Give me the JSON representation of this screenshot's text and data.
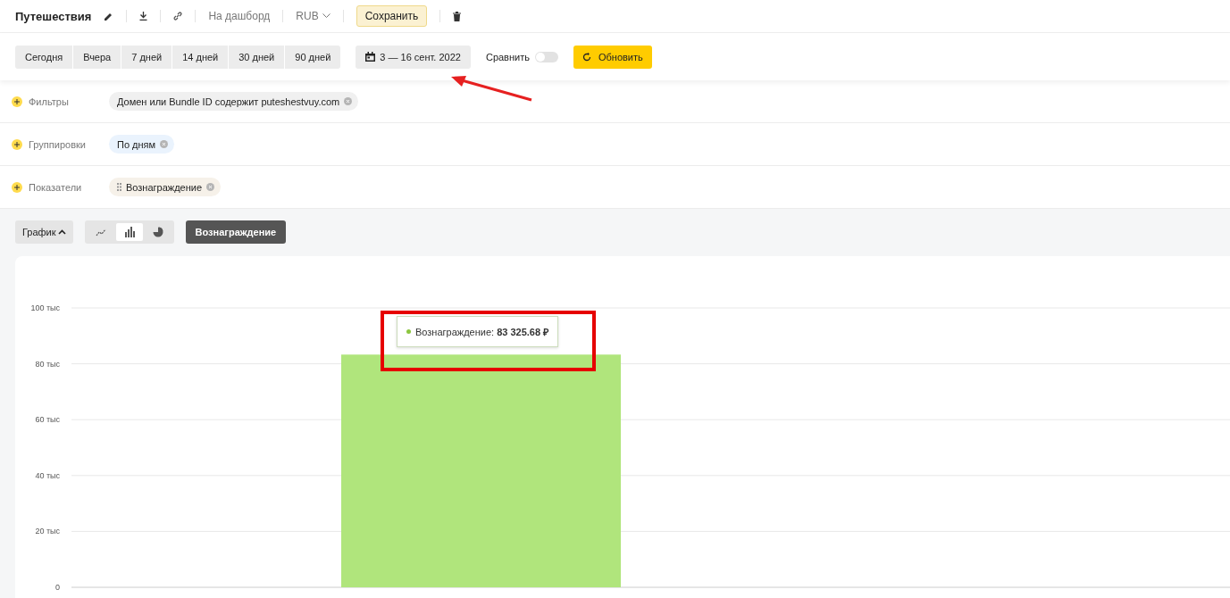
{
  "header": {
    "title": "Путешествия",
    "dashboard_link": "На дашборд",
    "currency": "RUB",
    "save": "Сохранить"
  },
  "periods": [
    {
      "label": "Сегодня",
      "selected": false
    },
    {
      "label": "Вчера",
      "selected": false
    },
    {
      "label": "7 дней",
      "selected": false
    },
    {
      "label": "14 дней",
      "selected": false
    },
    {
      "label": "30 дней",
      "selected": false
    },
    {
      "label": "90 дней",
      "selected": false
    }
  ],
  "date_range": "3 — 16 сент. 2022",
  "compare": {
    "label": "Сравнить",
    "on": false
  },
  "refresh": "Обновить",
  "rows": [
    {
      "kind": "filter",
      "label": "Фильтры",
      "chip": "Домен или Bundle ID содержит puteshestvuy.com"
    },
    {
      "kind": "grouping",
      "label": "Группировки",
      "chip": "По дням"
    },
    {
      "kind": "metric",
      "label": "Показатели",
      "chip": "Вознаграждение"
    }
  ],
  "view": {
    "toggle": "График",
    "expanded": true,
    "chart_types": [
      {
        "kind": "line",
        "selected": false
      },
      {
        "kind": "bar",
        "selected": true
      },
      {
        "kind": "pie",
        "selected": false
      }
    ],
    "metric": "Вознаграждение"
  },
  "chart": {
    "tooltip": {
      "text": "Вознаграждение: **83 325.68 ₽**",
      "color": "#8cc63f"
    },
    "chart_data": {
      "type": "bar",
      "grid": true,
      "series": [
        {
          "color": "#b0e57c",
          "values": [
            83.3
          ]
        }
      ],
      "ylim": [
        0,
        100
      ],
      "yticks": [
        {
          "value": 0,
          "label": "0"
        },
        {
          "value": 20,
          "label": "20 тыс"
        },
        {
          "value": 40,
          "label": "40 тыс"
        },
        {
          "value": 60,
          "label": "60 тыс"
        },
        {
          "value": 80,
          "label": "80 тыс"
        },
        {
          "value": 100,
          "label": "100 тыс"
        }
      ]
    }
  }
}
